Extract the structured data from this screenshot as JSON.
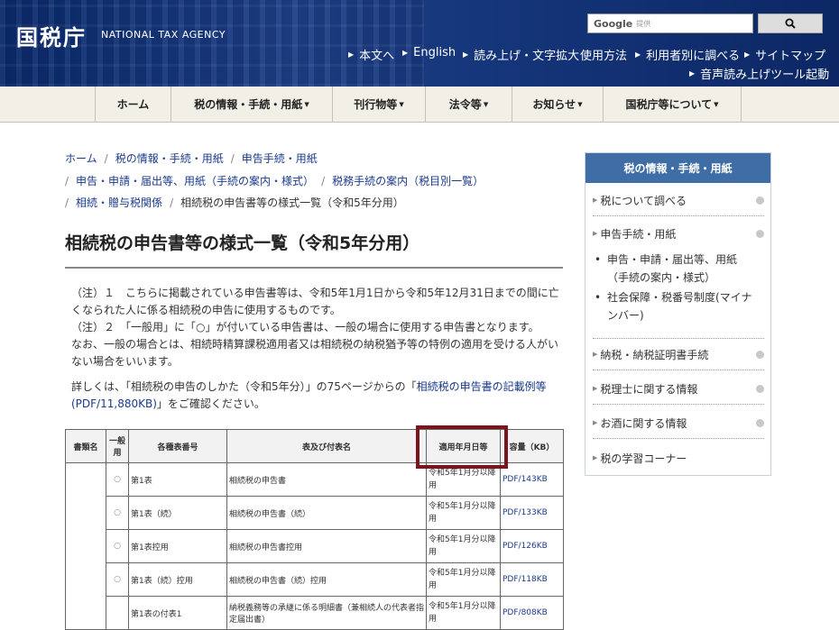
{
  "header": {
    "logo_text": "国税庁",
    "logo_en": "NATIONAL TAX AGENCY",
    "search_brand": "Google",
    "search_placeholder": "提供",
    "util_links": [
      "本文へ",
      "English",
      "読み上げ・文字拡大",
      "使用方法",
      "利用者別に調べる",
      "サイトマップ",
      "音声読み上げツール起動"
    ]
  },
  "gnav": [
    "ホーム",
    "税の情報・手続・用紙",
    "刊行物等",
    "法令等",
    "お知らせ",
    "国税庁等について"
  ],
  "breadcrumb": {
    "line1": [
      "ホーム",
      "税の情報・手続・用紙",
      "申告手続・用紙"
    ],
    "line2": [
      "申告・申請・届出等、用紙（手続の案内・様式）",
      "税務手続の案内（税目別一覧）"
    ],
    "line3_link": "相続・贈与税関係",
    "line3_current": "相続税の申告書等の様式一覧（令和5年分用）"
  },
  "page_title": "相続税の申告書等の様式一覧（令和5年分用）",
  "notes": {
    "n1": "（注）１　こちらに掲載されている申告書等は、令和5年1月1日から令和5年12月31日までの間に亡くなられた人に係る相続税の申告に使用するものです。",
    "n2a": "（注）２　「一般用」に「○」が付いている申告書は、一般の場合に使用する申告書となります。",
    "n2b": "なお、一般の場合とは、相続時精算課税適用者又は相続税の納税猶予等の特例の適用を受ける人がいない場合をいいます。",
    "n3_pre": "詳しくは、「相続税の申告のしかた（令和5年分）」の75ページからの「",
    "n3_link": "相続税の申告書の記載例等(PDF/11,880KB)",
    "n3_post": "」をご確認ください。"
  },
  "table": {
    "headers": [
      "書類名",
      "一般用",
      "各種表番号",
      "表及び付表名",
      "適用年月日等",
      "容量（KB）"
    ],
    "rows": [
      {
        "general": "○",
        "no": "第1表",
        "name": "相続税の申告書",
        "date": "令和5年1月分以降用",
        "size": "PDF/143KB"
      },
      {
        "general": "○",
        "no": "第1表（続）",
        "name": "相続税の申告書（続）",
        "date": "令和5年1月分以降用",
        "size": "PDF/133KB"
      },
      {
        "general": "○",
        "no": "第1表控用",
        "name": "相続税の申告書控用",
        "date": "令和5年1月分以降用",
        "size": "PDF/126KB"
      },
      {
        "general": "○",
        "no": "第1表（続）控用",
        "name": "相続税の申告書（続）控用",
        "date": "令和5年1月分以降用",
        "size": "PDF/118KB"
      },
      {
        "general": "",
        "no": "第1表の付表1",
        "name": "納税義務等の承継に係る明細書（兼相続人の代表者指定届出書）",
        "date": "令和5年1月分以降用",
        "size": "PDF/808KB"
      }
    ]
  },
  "side": {
    "title": "税の情報・手続・用紙",
    "items": [
      "税について調べる",
      "申告手続・用紙",
      "納税・納税証明書手続",
      "税理士に関する情報",
      "お酒に関する情報",
      "税の学習コーナー"
    ],
    "subitems": [
      "申告・申請・届出等、用紙（手続の案内・様式）",
      "社会保障・税番号制度(マイナンバー)"
    ]
  }
}
